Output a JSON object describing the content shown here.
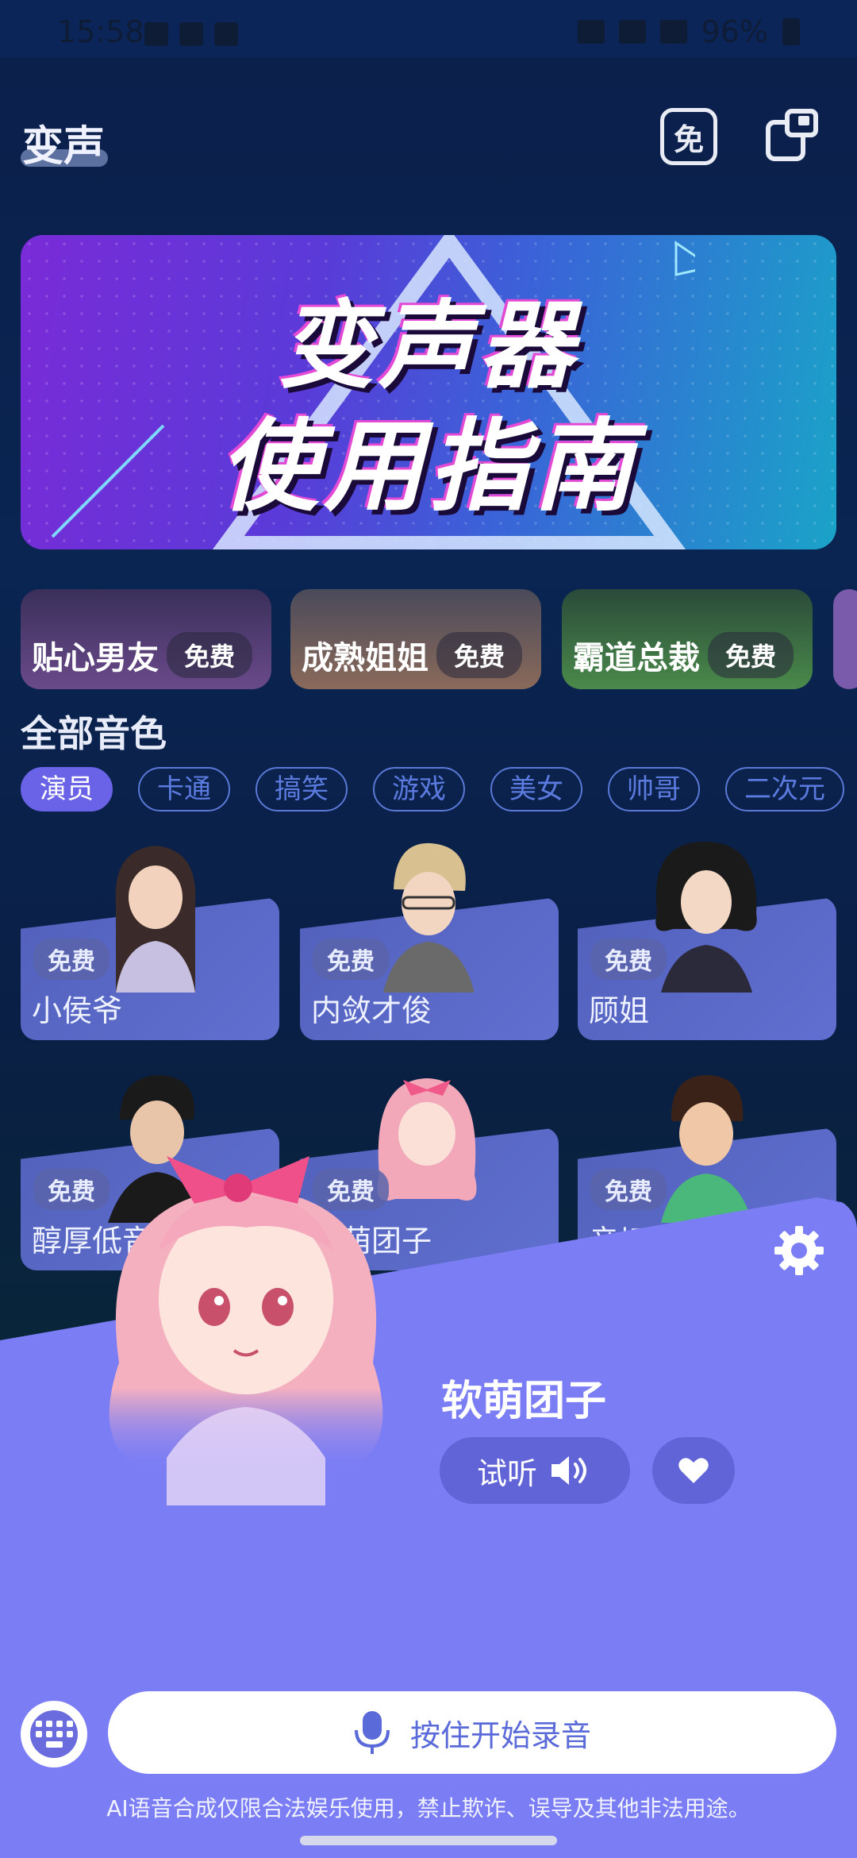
{
  "status_bar": {
    "time": "15:58",
    "battery": "96%"
  },
  "header": {
    "title": "变声",
    "free_icon_text": "免"
  },
  "banner": {
    "line1": "变声器",
    "line2": "使用指南"
  },
  "featured": [
    {
      "label": "贴心男友",
      "badge": "免费"
    },
    {
      "label": "成熟姐姐",
      "badge": "免费"
    },
    {
      "label": "霸道总裁",
      "badge": "免费"
    }
  ],
  "section": {
    "title": "全部音色"
  },
  "tabs": [
    "演员",
    "卡通",
    "搞笑",
    "游戏",
    "美女",
    "帅哥",
    "二次元"
  ],
  "voices": [
    {
      "name": "小侯爷",
      "badge": "免费"
    },
    {
      "name": "内敛才俊",
      "badge": "免费"
    },
    {
      "name": "顾姐",
      "badge": "免费"
    },
    {
      "name": "醇厚低音",
      "badge": "免费"
    },
    {
      "name": "软萌团子",
      "badge": "免费"
    },
    {
      "name": "亲切小哥",
      "badge": "免费"
    }
  ],
  "selected": {
    "name": "软萌团子",
    "listen_label": "试听"
  },
  "record": {
    "label": "按住开始录音"
  },
  "disclaimer": "AI语音合成仅限合法娱乐使用，禁止欺诈、误导及其他非法用途。",
  "colors": {
    "accent": "#7b7df5",
    "tab_active": "#6a63e8",
    "button_dark": "#6164d6"
  }
}
